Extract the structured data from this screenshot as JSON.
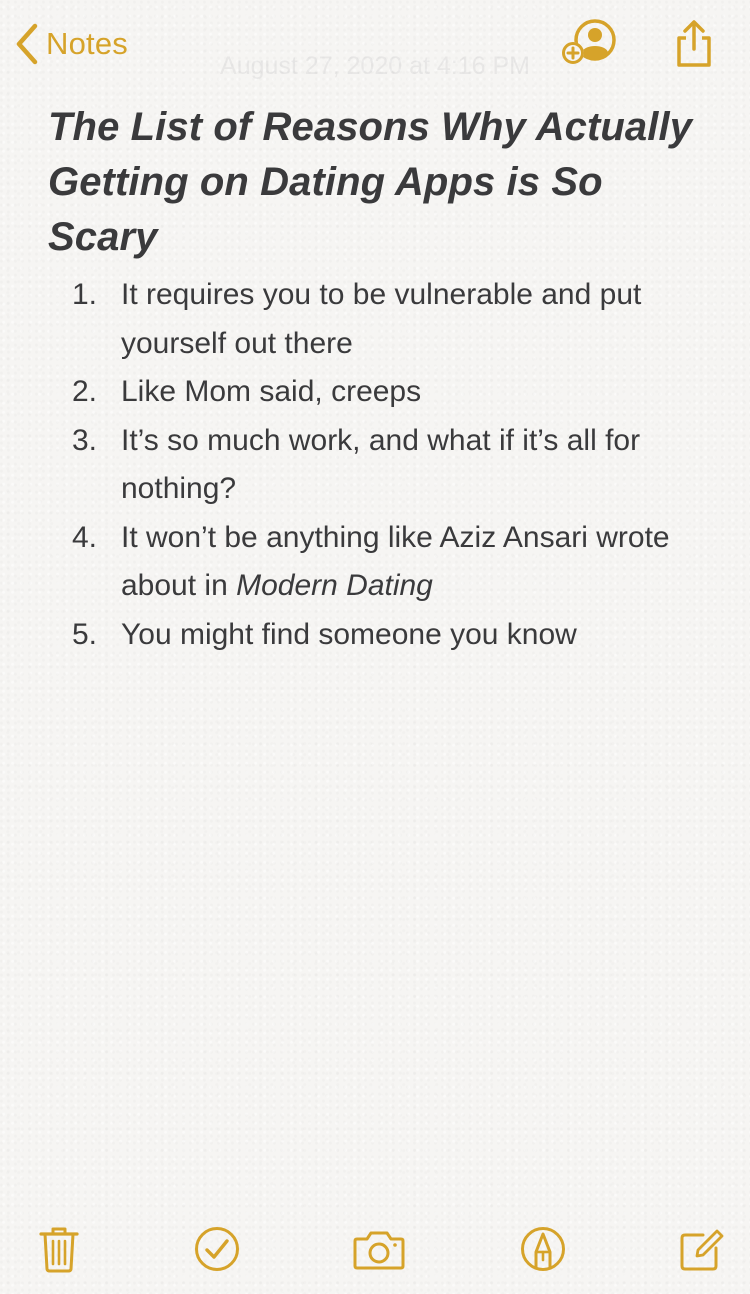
{
  "nav": {
    "back_label": "Notes",
    "date_faint": "August 27, 2020 at 4:16 PM",
    "icons": [
      "chevron-left-icon",
      "add-person-icon",
      "share-icon"
    ]
  },
  "note": {
    "title": "The List of Reasons Why Actually Getting on Dating Apps is So Scary",
    "items": [
      {
        "number": "1.",
        "text": "It requires you to be vulnerable and put yourself out there"
      },
      {
        "number": "2.",
        "text": "Like Mom said, creeps"
      },
      {
        "number": "3.",
        "text": "It’s so much work, and what if it’s all for nothing?"
      },
      {
        "number": "4.",
        "text_before": "It won’t be anything like Aziz Ansari wrote about in ",
        "text_italic": "Modern Dating"
      },
      {
        "number": "5.",
        "text": "You might find someone you know"
      }
    ]
  },
  "toolbar": {
    "icons": [
      "trash-icon",
      "checklist-icon",
      "camera-icon",
      "markup-icon",
      "compose-icon"
    ]
  },
  "colors": {
    "accent": "#d6a32a",
    "text": "#3a3a3c",
    "background": "#f6f5f3"
  }
}
